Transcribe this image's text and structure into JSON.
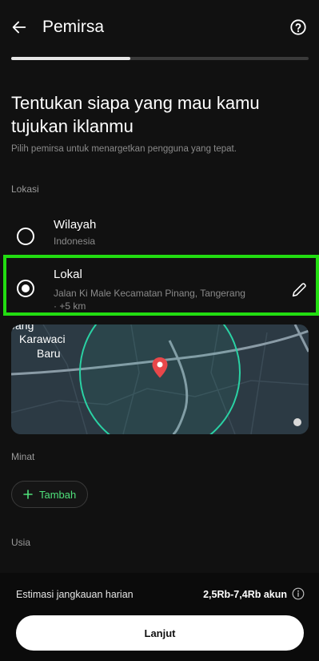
{
  "header": {
    "title": "Pemirsa",
    "back_icon": "arrow-left-icon",
    "help_icon": "help-circle-icon"
  },
  "progress": {
    "fraction": 0.4
  },
  "intro": {
    "heading": "Tentukan siapa yang mau kamu tujukan iklanmu",
    "subheading": "Pilih pemirsa untuk menargetkan pengguna yang tepat."
  },
  "location": {
    "label": "Lokasi",
    "options": [
      {
        "title": "Wilayah",
        "subtitle": "Indonesia",
        "selected": false
      },
      {
        "title": "Lokal",
        "subtitle": "Jalan Ki Male Kecamatan Pinang, Tangerang · +5 km",
        "selected": true
      }
    ],
    "map": {
      "place_label_1": "Karawaci",
      "place_label_2": "Baru",
      "place_label_top": "Jang",
      "pin_icon": "map-pin-icon"
    }
  },
  "interests": {
    "label": "Minat",
    "add_label": "Tambah"
  },
  "age": {
    "label": "Usia"
  },
  "footer": {
    "estimate_label": "Estimasi jangkauan harian",
    "estimate_value": "2,5Rb-7,4Rb akun",
    "next_label": "Lanjut"
  },
  "colors": {
    "background": "#111111",
    "accent_green": "#4ee07a",
    "highlight_green": "#22dd11",
    "pin_red": "#e8474a"
  }
}
